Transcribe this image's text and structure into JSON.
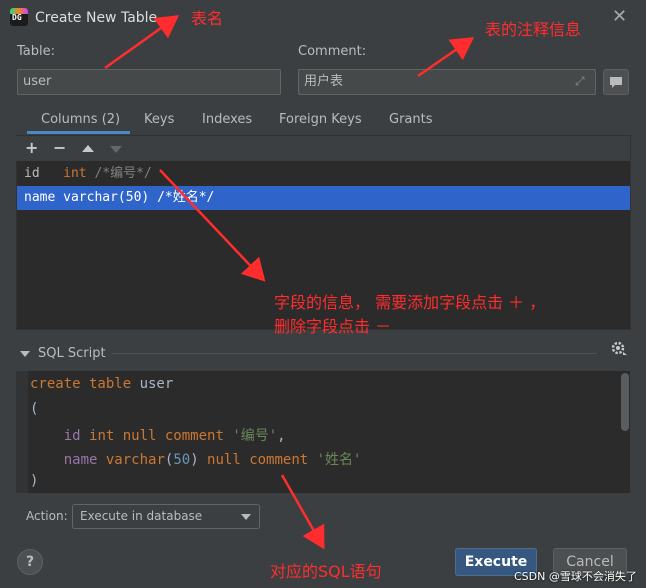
{
  "window": {
    "icon_text": "DG",
    "title": "Create New Table",
    "close_icon": "close-icon"
  },
  "form": {
    "table_label": "Table:",
    "table_value": "user",
    "comment_label": "Comment:",
    "comment_value": "用户表"
  },
  "tabs": [
    {
      "label": "Columns (2)",
      "active": true
    },
    {
      "label": "Keys"
    },
    {
      "label": "Indexes"
    },
    {
      "label": "Foreign Keys"
    },
    {
      "label": "Grants"
    }
  ],
  "toolbar": {
    "add": "+",
    "remove": "−"
  },
  "columns": [
    {
      "name": "id",
      "type": "int",
      "comment": "/*编号*/",
      "selected": false
    },
    {
      "name": "name",
      "type": "varchar(50)",
      "comment": "/*姓名*/",
      "selected": true
    }
  ],
  "sql_section": {
    "title": "SQL Script",
    "lines": [
      "create table user",
      "(",
      "    id int null comment '编号',",
      "    name varchar(50) null comment '姓名'",
      ")"
    ]
  },
  "footer": {
    "action_label": "Action:",
    "action_value": "Execute in database",
    "help": "?",
    "execute": "Execute",
    "cancel": "Cancel"
  },
  "annotations": {
    "table_name": "表名",
    "table_comment": "表的注释信息",
    "fields_line1": "字段的信息， 需要添加字段点击 ＋ ，",
    "fields_line2": "删除字段点击 －",
    "sql": "对应的SQL语句"
  },
  "watermark": "CSDN @雪球不会消失了",
  "colors": {
    "background": "#3c3f41",
    "accent": "#4a88c7",
    "selection": "#2f65ca",
    "annotation": "#ff2d2d",
    "primary_button": "#365880"
  }
}
